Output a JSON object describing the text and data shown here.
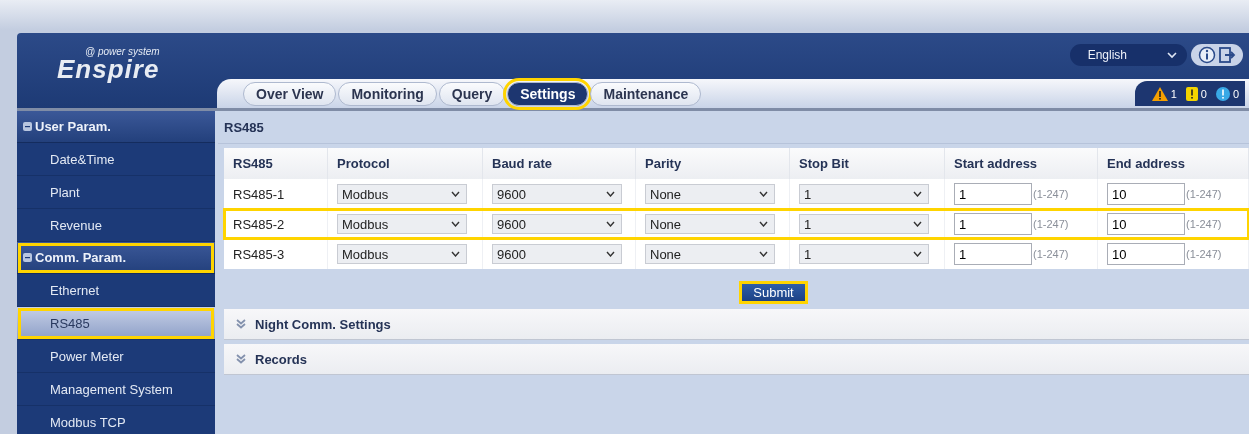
{
  "header": {
    "logo": {
      "subtitle": "@ power system",
      "name": "Enspire"
    },
    "language": "English",
    "tabs": [
      {
        "label": "Over View",
        "selected": false,
        "highlighted": false
      },
      {
        "label": "Monitoring",
        "selected": false,
        "highlighted": false
      },
      {
        "label": "Query",
        "selected": false,
        "highlighted": false
      },
      {
        "label": "Settings",
        "selected": true,
        "highlighted": true
      },
      {
        "label": "Maintenance",
        "selected": false,
        "highlighted": false
      }
    ],
    "alarms": [
      {
        "kind": "major",
        "count": "1"
      },
      {
        "kind": "minor",
        "count": "0"
      },
      {
        "kind": "info",
        "count": "0"
      }
    ]
  },
  "sidebar": {
    "groups": [
      {
        "label": "User Param.",
        "expanded": true,
        "highlighted": false,
        "items": [
          {
            "label": "Date&Time",
            "selected": false,
            "highlighted": false
          },
          {
            "label": "Plant",
            "selected": false,
            "highlighted": false
          },
          {
            "label": "Revenue",
            "selected": false,
            "highlighted": false
          }
        ]
      },
      {
        "label": "Comm. Param.",
        "expanded": true,
        "highlighted": true,
        "items": [
          {
            "label": "Ethernet",
            "selected": false,
            "highlighted": false
          },
          {
            "label": "RS485",
            "selected": true,
            "highlighted": true
          },
          {
            "label": "Power Meter",
            "selected": false,
            "highlighted": false
          },
          {
            "label": "Management System",
            "selected": false,
            "highlighted": false
          },
          {
            "label": "Modbus TCP",
            "selected": false,
            "highlighted": false
          }
        ]
      }
    ]
  },
  "content": {
    "title": "RS485",
    "table": {
      "columns": [
        "RS485",
        "Protocol",
        "Baud rate",
        "Parity",
        "Stop Bit",
        "Start address",
        "End address"
      ],
      "rows": [
        {
          "port": "RS485-1",
          "protocol": "Modbus",
          "baud_rate": "9600",
          "parity": "None",
          "stop_bit": "1",
          "start_address": "1",
          "start_range": "(1-247)",
          "end_address": "10",
          "end_range": "(1-247)",
          "highlighted": false
        },
        {
          "port": "RS485-2",
          "protocol": "Modbus",
          "baud_rate": "9600",
          "parity": "None",
          "stop_bit": "1",
          "start_address": "1",
          "start_range": "(1-247)",
          "end_address": "10",
          "end_range": "(1-247)",
          "highlighted": true
        },
        {
          "port": "RS485-3",
          "protocol": "Modbus",
          "baud_rate": "9600",
          "parity": "None",
          "stop_bit": "1",
          "start_address": "1",
          "start_range": "(1-247)",
          "end_address": "10",
          "end_range": "(1-247)",
          "highlighted": false
        }
      ]
    },
    "submit": {
      "label": "Submit",
      "highlighted": true
    },
    "sections": [
      {
        "label": "Night Comm. Settings",
        "expanded": false
      },
      {
        "label": "Records",
        "expanded": false
      }
    ]
  }
}
